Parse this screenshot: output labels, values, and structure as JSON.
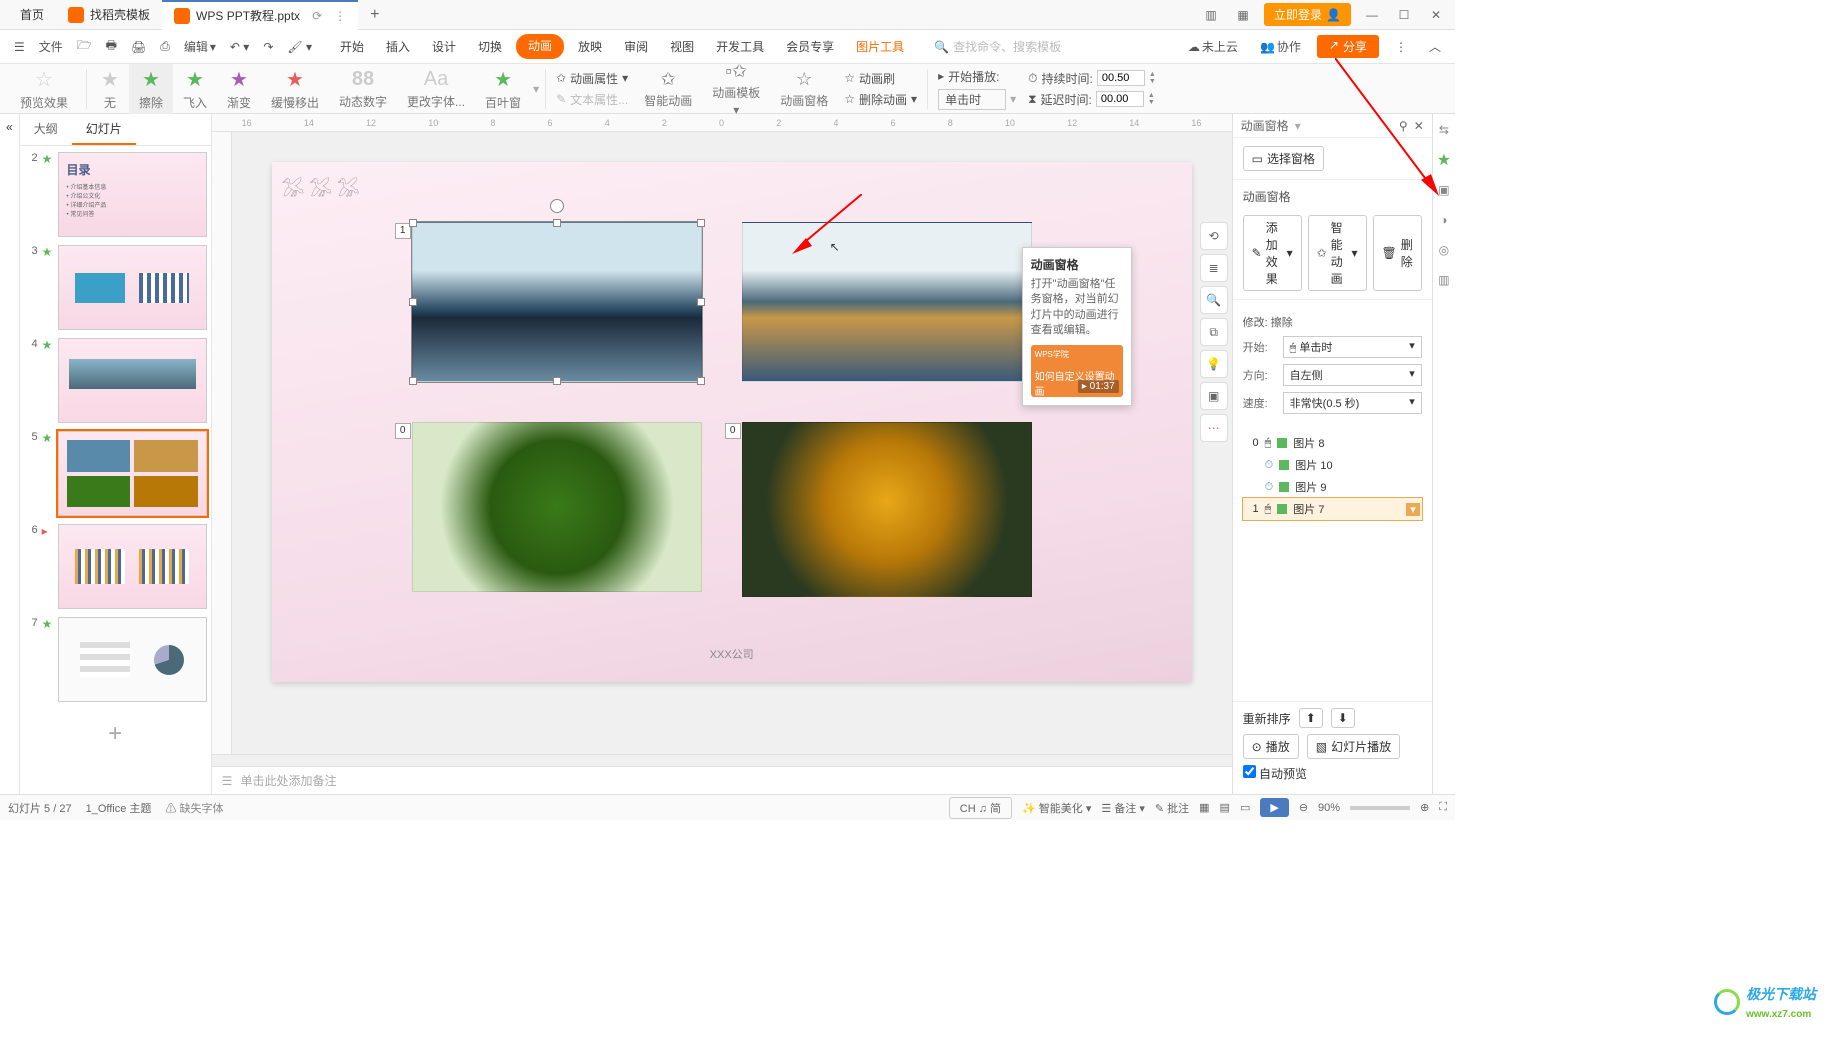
{
  "title_tabs": {
    "home": "首页",
    "search_template": "找稻壳模板",
    "doc_name": "WPS PPT教程.pptx",
    "add": "+"
  },
  "title_right": {
    "login": "立即登录"
  },
  "menu": {
    "file": "文件",
    "edit": "编辑",
    "tabs": [
      "开始",
      "插入",
      "设计",
      "切换",
      "动画",
      "放映",
      "审阅",
      "视图",
      "开发工具",
      "会员专享"
    ],
    "picture_tools": "图片工具",
    "search_placeholder": "查找命令、搜索模板",
    "cloud": "未上云",
    "collab": "协作",
    "share": "分享"
  },
  "ribbon": {
    "preview": "预览效果",
    "presets": [
      "无",
      "擦除",
      "飞入",
      "渐变",
      "缓慢移出",
      "动态数字",
      "更改字体...",
      "百叶窗"
    ],
    "anim_attr": "动画属性",
    "text_attr": "文本属性...",
    "smart_anim": "智能动画",
    "anim_template": "动画模板",
    "anim_pane": "动画窗格",
    "anim_brush": "动画刷",
    "delete_anim": "删除动画",
    "start_play": "开始播放:",
    "duration": "持续时间:",
    "delay": "延迟时间:",
    "on_click": "单击时",
    "duration_val": "00.50",
    "delay_val": "00.00"
  },
  "slide_panel": {
    "outline": "大纲",
    "slides": "幻灯片",
    "thumb_labels": {
      "2": "目录",
      "bullets": [
        "介绍基本信息",
        "介绍公文化",
        "详细介绍产品",
        "常见问答"
      ]
    },
    "nums": [
      "2",
      "3",
      "4",
      "5",
      "6",
      "7"
    ]
  },
  "canvas": {
    "badge1": "1",
    "badge0": "0",
    "company": "XXX公司"
  },
  "tooltip": {
    "title": "动画窗格",
    "body": "打开\"动画窗格\"任务窗格，对当前幻灯片中的动画进行查看或编辑。",
    "video_text": "如何自定义设置动画",
    "video_time": "01:37"
  },
  "right": {
    "pane_title": "动画窗格",
    "select_pane": "选择窗格",
    "anim_pane_label": "动画窗格",
    "add_effect": "添加效果",
    "smart_anim": "智能动画",
    "delete": "删除",
    "modify": "修改: 擦除",
    "start": "开始:",
    "start_val": "单击时",
    "direction": "方向:",
    "direction_val": "自左侧",
    "speed": "速度:",
    "speed_val": "非常快(0.5 秒)",
    "items": [
      {
        "n": "0",
        "name": "图片 8"
      },
      {
        "n": "",
        "name": "图片 10"
      },
      {
        "n": "",
        "name": "图片 9"
      },
      {
        "n": "1",
        "name": "图片 7"
      }
    ],
    "reorder": "重新排序",
    "play": "播放",
    "slideshow": "幻灯片播放",
    "auto_preview": "自动预览"
  },
  "status": {
    "slide": "幻灯片 5 / 27",
    "theme": "1_Office 主题",
    "missing_font": "缺失字体",
    "note_placeholder": "单击此处添加备注",
    "ime": "CH ♫ 简",
    "beautify": "智能美化",
    "notes": "备注",
    "comment": "批注",
    "zoom": "90%"
  },
  "watermark": {
    "name": "极光下载站",
    "url": "www.xz7.com"
  }
}
